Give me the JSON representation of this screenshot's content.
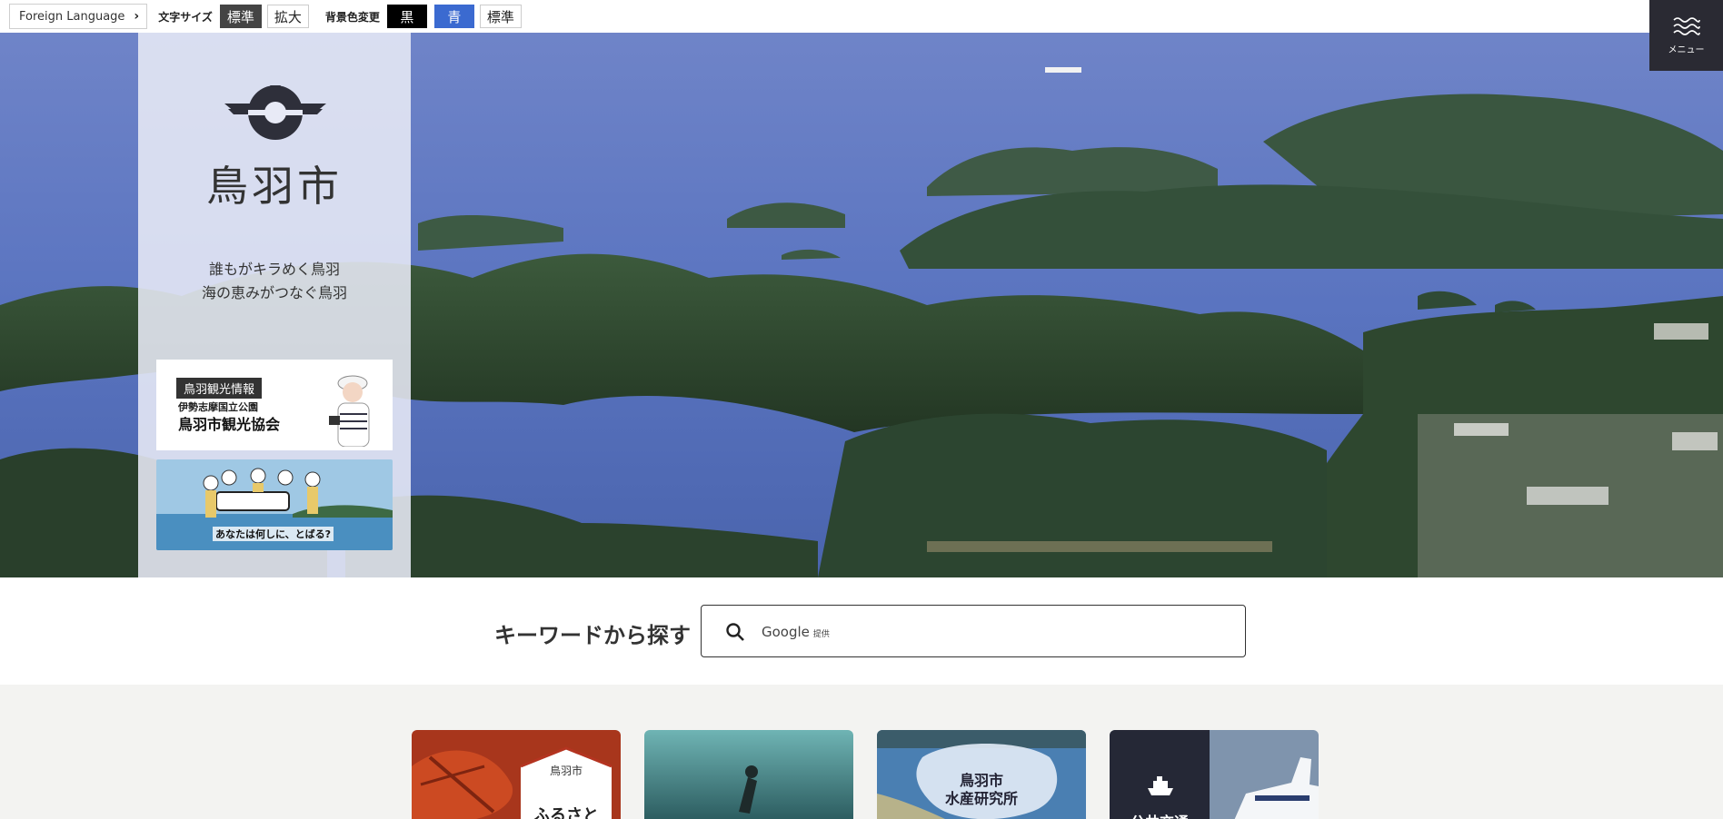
{
  "topbar": {
    "foreign_language": "Foreign Language",
    "font_size_label": "文字サイズ",
    "font_size_standard": "標準",
    "font_size_large": "拡大",
    "bg_color_label": "背景色変更",
    "bg_black": "黒",
    "bg_blue": "青",
    "bg_standard": "標準"
  },
  "menu": {
    "label": "メニュー"
  },
  "brand": {
    "city_name": "鳥羽市",
    "tagline_line1": "誰もがキラめく鳥羽",
    "tagline_line2": "海の恵みがつなぐ鳥羽"
  },
  "banners": {
    "tourism_tag": "鳥羽観光情報",
    "tourism_sub": "伊勢志摩国立公園",
    "tourism_main": "鳥羽市観光協会",
    "tobu_caption": "あなたは何しに、とばる?"
  },
  "search": {
    "label": "キーワードから探す",
    "provider": "Google",
    "provider_suffix": "提供"
  },
  "cards": {
    "furusato_small": "鳥羽市",
    "furusato_big": "ふるさと",
    "fishery_line1": "鳥羽市",
    "fishery_line2": "水産研究所",
    "transit": "公共交通"
  }
}
